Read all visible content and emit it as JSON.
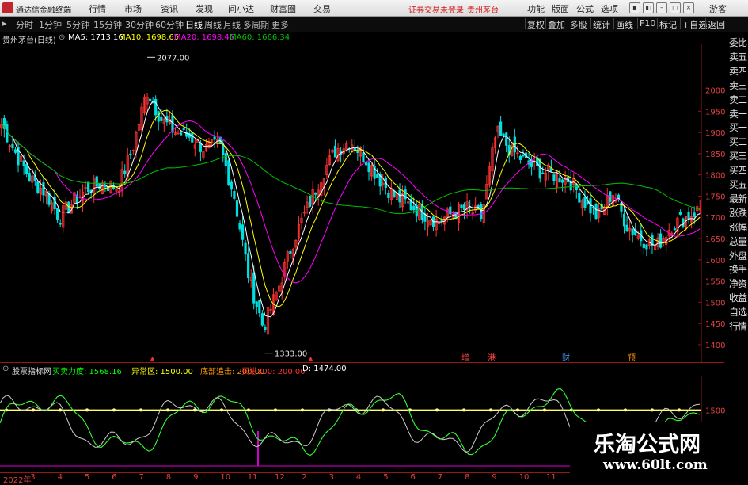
{
  "menubar": {
    "app_name": "通达信金融终端",
    "items": [
      "行情",
      "市场",
      "资讯",
      "发现",
      "问小达",
      "财富圈",
      "交易"
    ],
    "warning": "证券交易未登录",
    "stock": "贵州茅台",
    "right_items": [
      "功能",
      "版面",
      "公式",
      "选项"
    ],
    "user": "游客"
  },
  "toolbar": {
    "periods": [
      "分时",
      "1分钟",
      "5分钟",
      "15分钟",
      "30分钟",
      "60分钟",
      "日线",
      "周线",
      "月线",
      "多周期",
      "更多"
    ],
    "active": "日线",
    "right_buttons": [
      "复权",
      "叠加",
      "多股",
      "统计",
      "画线",
      "F10",
      "标记",
      "+自选",
      "返回"
    ]
  },
  "info": {
    "title": "贵州茅台(日线)",
    "ma5": "MA5: 1713.16",
    "ma10": "MA10: 1698.65",
    "ma20": "MA20: 1698.45",
    "ma60": "MA60: 1666.34",
    "colors": {
      "ma5": "#ffffff",
      "ma10": "#ffff00",
      "ma20": "#ff00ff",
      "ma60": "#00c000"
    }
  },
  "price_labels": {
    "high": "2077.00",
    "low": "1333.00"
  },
  "event_marks": [
    "增",
    "港",
    "财",
    "预"
  ],
  "indicator": {
    "name": "股票指标网",
    "l1": "买卖力度: 1568.16",
    "l2": "异常区: 1500.00",
    "l3": "底部追击: 200.00",
    "l4": "买进300: 200.00",
    "l5": "D: 1474.00",
    "colors": {
      "l1": "#00ff00",
      "l2": "#ffff00",
      "l3": "#ff9900",
      "l4": "#ff3333",
      "l5": "#ffffff"
    }
  },
  "xaxis": {
    "labels": [
      "2022年",
      "3",
      "4",
      "5",
      "6",
      "7",
      "8",
      "9",
      "10",
      "11",
      "12",
      "2",
      "3",
      "4",
      "5",
      "6",
      "7",
      "8",
      "9",
      "10",
      "11"
    ]
  },
  "side_items": [
    "委比",
    "卖五",
    "卖四",
    "卖三",
    "卖二",
    "卖一",
    "买一",
    "买二",
    "买三",
    "买四",
    "买五",
    "最新",
    "涨跌",
    "涨幅",
    "总量",
    "外盘",
    "换手",
    "净资",
    "收益",
    "自选",
    "行情"
  ],
  "watermark": {
    "line1": "乐淘公式网",
    "line2": "www.60lt.com"
  },
  "chart_data": {
    "type": "candlestick",
    "title": "贵州茅台(日线)",
    "ylim": [
      1370,
      2100
    ],
    "yticks": [
      2000,
      1950,
      1900,
      1850,
      1800,
      1750,
      1700,
      1650,
      1600,
      1550,
      1500,
      1450,
      1400
    ],
    "xlabels": [
      "2022年",
      "3",
      "4",
      "5",
      "6",
      "7",
      "8",
      "9",
      "10",
      "11",
      "12",
      "2",
      "3",
      "4",
      "5",
      "6",
      "7",
      "8",
      "9",
      "10",
      "11"
    ],
    "close": [
      1920,
      1850,
      1790,
      1760,
      1700,
      1740,
      1770,
      1780,
      1770,
      1860,
      2000,
      1930,
      1900,
      1890,
      1860,
      1870,
      1750,
      1560,
      1440,
      1530,
      1640,
      1720,
      1800,
      1860,
      1880,
      1840,
      1790,
      1750,
      1730,
      1710,
      1690,
      1710,
      1720,
      1700,
      1900,
      1860,
      1830,
      1810,
      1800,
      1790,
      1740,
      1700,
      1760,
      1680,
      1650,
      1630,
      1680,
      1700,
      1720
    ],
    "series": [
      {
        "name": "MA5",
        "last": 1713.16
      },
      {
        "name": "MA10",
        "last": 1698.65
      },
      {
        "name": "MA20",
        "last": 1698.45
      },
      {
        "name": "MA60",
        "last": 1666.34
      }
    ],
    "indicator": {
      "name": "股票指标网",
      "ylim": [
        1400,
        1550
      ],
      "yticks": [
        1500
      ],
      "reference": 1500.0
    }
  }
}
